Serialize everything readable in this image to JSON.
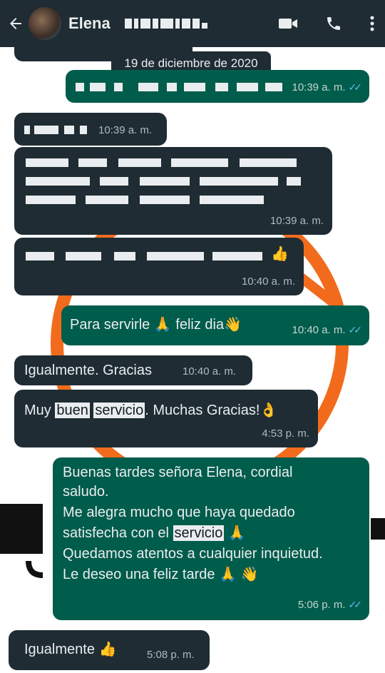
{
  "header": {
    "contact_name": "Elena",
    "colors": {
      "bar": "#1f2c34",
      "text": "#e9edef"
    },
    "icons": [
      "back-arrow-icon",
      "video-call-icon",
      "phone-icon",
      "more-menu-icon"
    ]
  },
  "date_chip": "19 de diciembre de 2020",
  "messages": [
    {
      "dir": "out",
      "text": "",
      "time": "10:39 a. m.",
      "read": true
    },
    {
      "dir": "in",
      "text": "",
      "time": "10:39 a. m."
    },
    {
      "dir": "in",
      "text": "",
      "time": "10:39 a. m."
    },
    {
      "dir": "in",
      "text": "",
      "time": "10:40 a. m."
    },
    {
      "dir": "out",
      "text": "Para servirle 🙏 feliz dia👋",
      "text_a": "Para servirle",
      "text_b": "feliz dia",
      "time": "10:40 a. m.",
      "read": true
    },
    {
      "dir": "in",
      "text": "Igualmente. Gracias",
      "time": "10:40 a. m."
    },
    {
      "dir": "in",
      "text_a": "Muy",
      "hl1": "buen",
      "hl2": "servicio",
      "text_b": ". Muchas Gracias!",
      "time": "4:53 p. m."
    },
    {
      "dir": "out",
      "line1": "Buenas tardes señora Elena, cordial",
      "line2": "saludo.",
      "line3": "Me alegra mucho que haya quedado",
      "line4a": "satisfecha con el",
      "line4hl": "servicio",
      "line5": "Quedamos atentos a cualquier inquietud.",
      "line6": "Le deseo una feliz tarde",
      "time": "5:06 p. m.",
      "read": true
    },
    {
      "dir": "in",
      "text": "Igualmente",
      "time": "5:08 p. m."
    }
  ],
  "colors": {
    "incoming": "#1f2c34",
    "outgoing": "#005c4b",
    "read_ticks": "#53bdeb",
    "wallpaper_accent": "#f26b1d"
  }
}
